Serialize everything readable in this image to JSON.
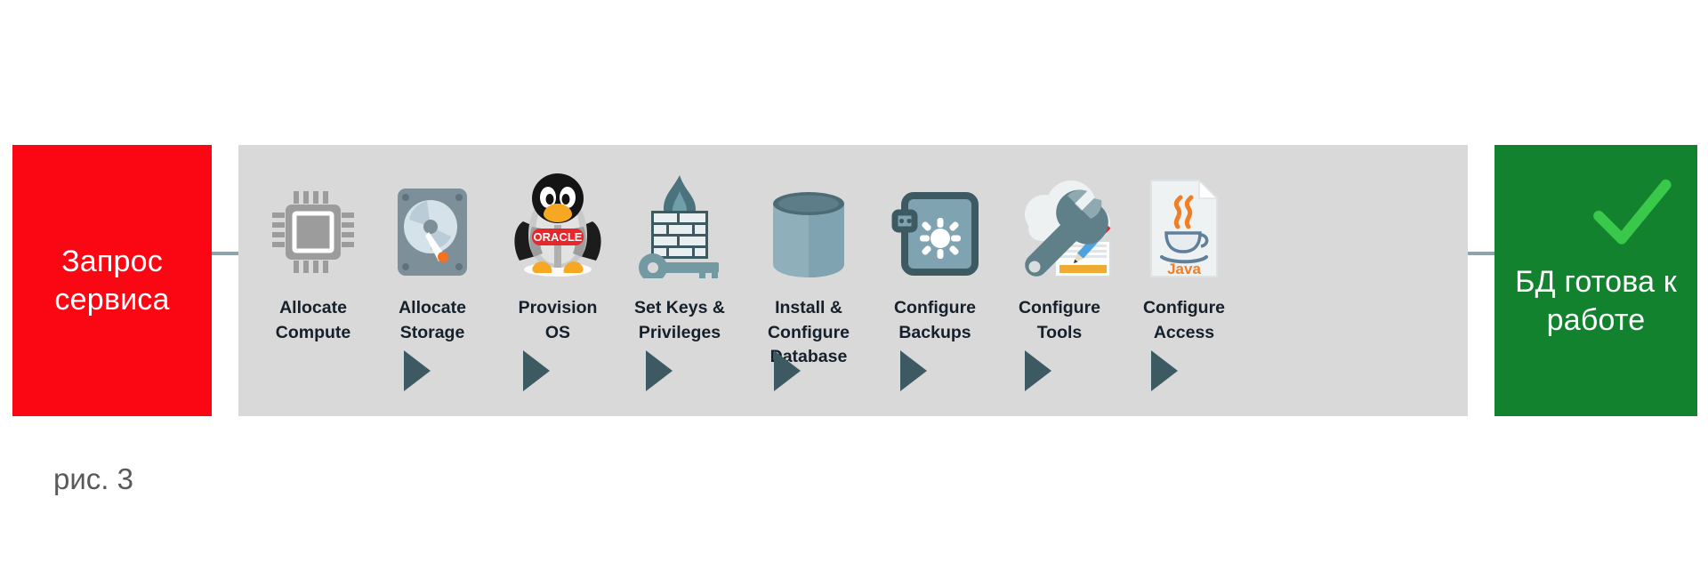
{
  "diagram": {
    "start_box": {
      "label": "Запрос\nсервиса",
      "color": "#fb0713"
    },
    "end_box": {
      "label": "БД готова\nк работе",
      "color": "#13822f",
      "check_icon": "check-icon",
      "check_color": "#39c84a"
    },
    "panel": {
      "color": "#d9d9d9"
    },
    "arrow_color": "#3d5a63",
    "connector_color": "#8fa3ad",
    "steps": [
      {
        "id": "allocate-compute",
        "label": "Allocate\nCompute",
        "icon": "cpu-chip-icon"
      },
      {
        "id": "allocate-storage",
        "label": "Allocate\nStorage",
        "icon": "hard-drive-icon"
      },
      {
        "id": "provision-os",
        "label": "Provision\nOS",
        "icon": "linux-penguin-oracle-icon"
      },
      {
        "id": "set-keys",
        "label": "Set Keys &\nPrivileges",
        "icon": "firewall-key-icon"
      },
      {
        "id": "install-database",
        "label": "Install &\nConfigure\nDatabase",
        "icon": "database-cylinder-icon"
      },
      {
        "id": "configure-backups",
        "label": "Configure\nBackups",
        "icon": "safe-vault-icon"
      },
      {
        "id": "configure-tools",
        "label": "Configure\nTools",
        "icon": "cloud-wrench-icon"
      },
      {
        "id": "configure-access",
        "label": "Configure\nAccess",
        "icon": "java-file-icon"
      }
    ],
    "penguin_badge": "ORACLE",
    "java_label": "Java"
  },
  "caption": {
    "text": "рис. 3"
  }
}
